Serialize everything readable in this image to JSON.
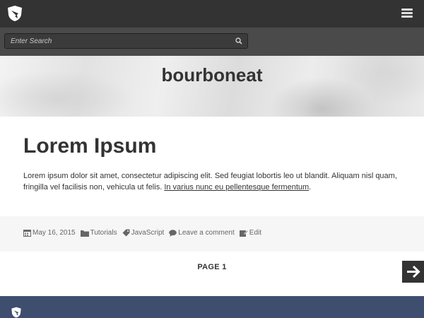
{
  "header": {
    "logo_icon": "shield-quill-icon",
    "menu_icon": "hamburger-menu-icon"
  },
  "search": {
    "placeholder": "Enter Search",
    "icon": "search-icon"
  },
  "site": {
    "title": "bourboneat"
  },
  "post": {
    "title": "Lorem Ipsum",
    "body_text": "Lorem ipsum dolor sit amet, consectetur adipiscing elit. Sed feugiat lobortis leo ut blandit. Aliquam nisl quam, fringilla vel facilisis non, vehicula ut felis. ",
    "link_text": "In varius nunc eu pellentesque fermentum",
    "body_end": "."
  },
  "meta": {
    "date": "May 16, 2015",
    "category": "Tutorials",
    "tag": "JavaScript",
    "comment": "Leave a comment",
    "edit": "Edit"
  },
  "pagination": {
    "label": "PAGE 1",
    "next_icon": "arrow-right-icon"
  },
  "footer": {
    "logo_icon": "shield-quill-icon"
  },
  "colors": {
    "topbar": "#333333",
    "searchbar": "#4a4a4a",
    "footer": "#3e4e6e",
    "text": "#333333"
  }
}
